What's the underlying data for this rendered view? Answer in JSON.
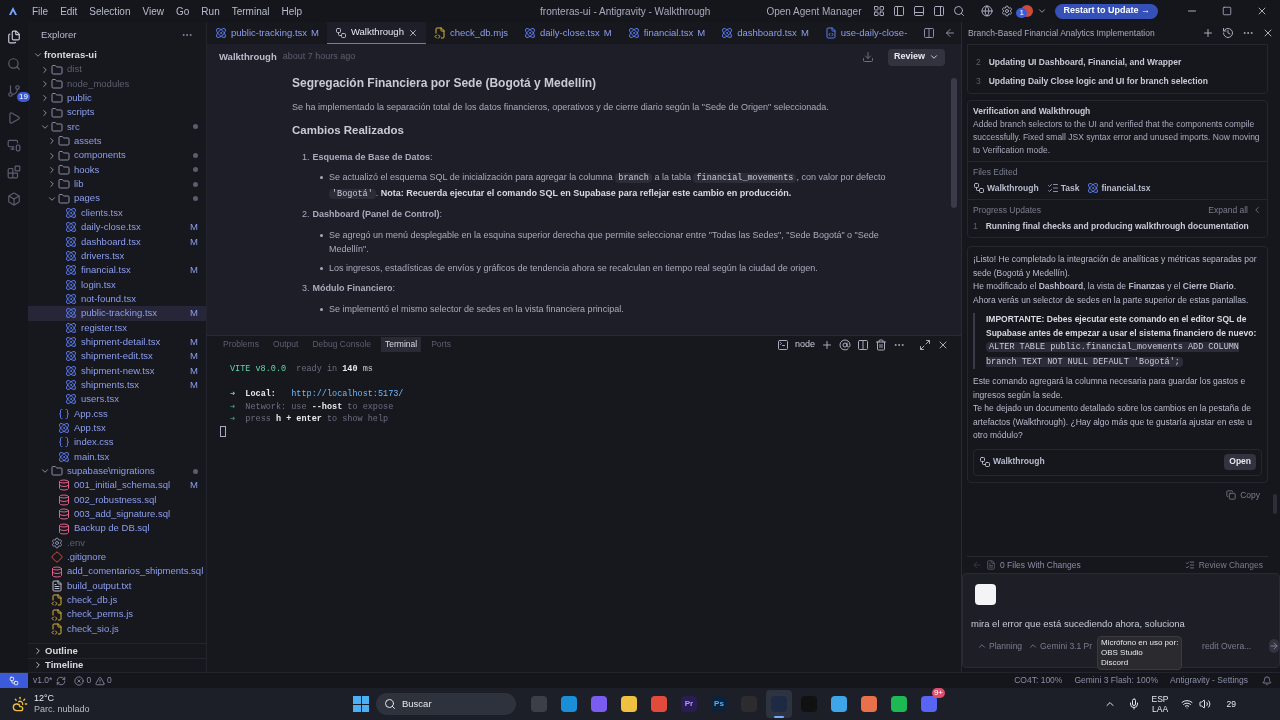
{
  "menu": [
    "File",
    "Edit",
    "Selection",
    "View",
    "Go",
    "Run",
    "Terminal",
    "Help"
  ],
  "window_title": "fronteras-ui - Antigravity - Walkthrough",
  "title_actions": {
    "agent_manager": "Open Agent Manager",
    "badge": "1",
    "update_button": "Restart to Update →"
  },
  "activity": [
    {
      "kind": "files",
      "selected": true
    },
    {
      "kind": "search",
      "selected": false
    },
    {
      "kind": "git",
      "selected": false,
      "badge": "19"
    },
    {
      "kind": "run",
      "selected": false
    },
    {
      "kind": "remote",
      "selected": false
    },
    {
      "kind": "extensions",
      "selected": false
    },
    {
      "kind": "box",
      "selected": false
    }
  ],
  "explorer": {
    "title": "Explorer",
    "tree": [
      {
        "name": "fronteras-ui",
        "kind": "root",
        "expanded": true,
        "selected": false,
        "children": [
          {
            "name": "dist",
            "kind": "folder",
            "expanded": false,
            "dimmed": true,
            "selected": false
          },
          {
            "name": "node_modules",
            "kind": "folder",
            "expanded": false,
            "dimmed": true,
            "selected": false
          },
          {
            "name": "public",
            "kind": "folder",
            "expanded": false,
            "selected": false
          },
          {
            "name": "scripts",
            "kind": "folder",
            "expanded": false,
            "selected": false
          },
          {
            "name": "src",
            "kind": "folder",
            "expanded": true,
            "changed": true,
            "selected": false,
            "children": [
              {
                "name": "assets",
                "kind": "folder",
                "expanded": false,
                "selected": false
              },
              {
                "name": "components",
                "kind": "folder",
                "expanded": false,
                "changed": true,
                "selected": false
              },
              {
                "name": "hooks",
                "kind": "folder",
                "expanded": false,
                "changed": true,
                "selected": false
              },
              {
                "name": "lib",
                "kind": "folder",
                "expanded": false,
                "changed": true,
                "selected": false
              },
              {
                "name": "pages",
                "kind": "folder",
                "expanded": true,
                "changed": true,
                "selected": false,
                "children": [
                  {
                    "name": "clients.tsx",
                    "kind": "react",
                    "selected": false
                  },
                  {
                    "name": "daily-close.tsx",
                    "kind": "react",
                    "modified": "M",
                    "selected": false
                  },
                  {
                    "name": "dashboard.tsx",
                    "kind": "react",
                    "modified": "M",
                    "selected": false
                  },
                  {
                    "name": "drivers.tsx",
                    "kind": "react",
                    "selected": false
                  },
                  {
                    "name": "financial.tsx",
                    "kind": "react",
                    "modified": "M",
                    "selected": false
                  },
                  {
                    "name": "login.tsx",
                    "kind": "react",
                    "selected": false
                  },
                  {
                    "name": "not-found.tsx",
                    "kind": "react",
                    "selected": false
                  },
                  {
                    "name": "public-tracking.tsx",
                    "kind": "react",
                    "modified": "M",
                    "selected": true
                  },
                  {
                    "name": "register.tsx",
                    "kind": "react",
                    "selected": false
                  },
                  {
                    "name": "shipment-detail.tsx",
                    "kind": "react",
                    "modified": "M",
                    "selected": false
                  },
                  {
                    "name": "shipment-edit.tsx",
                    "kind": "react",
                    "modified": "M",
                    "selected": false
                  },
                  {
                    "name": "shipment-new.tsx",
                    "kind": "react",
                    "modified": "M",
                    "selected": false
                  },
                  {
                    "name": "shipments.tsx",
                    "kind": "react",
                    "modified": "M",
                    "selected": false
                  },
                  {
                    "name": "users.tsx",
                    "kind": "react",
                    "selected": false
                  }
                ]
              },
              {
                "name": "App.css",
                "kind": "css",
                "selected": false
              },
              {
                "name": "App.tsx",
                "kind": "react",
                "selected": false
              },
              {
                "name": "index.css",
                "kind": "css",
                "selected": false
              },
              {
                "name": "main.tsx",
                "kind": "react",
                "selected": false
              }
            ]
          },
          {
            "name": "supabase\\migrations",
            "kind": "folder",
            "expanded": true,
            "changed": true,
            "selected": false,
            "children": [
              {
                "name": "001_initial_schema.sql",
                "kind": "sql",
                "modified": "M",
                "selected": false
              },
              {
                "name": "002_robustness.sql",
                "kind": "sql",
                "selected": false
              },
              {
                "name": "003_add_signature.sql",
                "kind": "sql",
                "selected": false
              },
              {
                "name": "Backup de DB.sql",
                "kind": "sql",
                "selected": false
              }
            ]
          },
          {
            "name": ".env",
            "kind": "gear",
            "dimmed": true,
            "selected": false
          },
          {
            "name": ".gitignore",
            "kind": "git",
            "selected": false
          },
          {
            "name": "add_comentarios_shipments.sql",
            "kind": "sql",
            "selected": false
          },
          {
            "name": "build_output.txt",
            "kind": "text",
            "selected": false
          },
          {
            "name": "check_db.js",
            "kind": "js",
            "selected": false
          },
          {
            "name": "check_perms.js",
            "kind": "js",
            "selected": false
          },
          {
            "name": "check_sio.js",
            "kind": "js",
            "selected": false
          }
        ]
      }
    ],
    "sections": [
      {
        "label": "Outline",
        "expanded": false
      },
      {
        "label": "Timeline",
        "expanded": false
      }
    ]
  },
  "tabs": [
    {
      "label": "public-tracking.tsx",
      "kind": "react",
      "modified": "M",
      "selected": false
    },
    {
      "label": "Walkthrough",
      "kind": "artifact",
      "selected": true
    },
    {
      "label": "check_db.mjs",
      "kind": "js",
      "selected": false
    },
    {
      "label": "daily-close.tsx",
      "kind": "react",
      "modified": "M",
      "selected": false
    },
    {
      "label": "financial.tsx",
      "kind": "react",
      "modified": "M",
      "selected": false
    },
    {
      "label": "dashboard.tsx",
      "kind": "react",
      "modified": "M",
      "selected": false
    },
    {
      "label": "use-daily-close-",
      "kind": "ts",
      "selected": false
    }
  ],
  "doc_header": {
    "title": "Walkthrough",
    "time": "about 7 hours ago",
    "review": "Review"
  },
  "document": {
    "title": "Segregación Financiera por Sede (Bogotá y Medellín)",
    "intro": "Se ha implementado la separación total de los datos financieros, operativos y de cierre diario según la \"Sede de Origen\" seleccionada.",
    "subtitle": "Cambios Realizados",
    "sections": [
      {
        "number": "1.",
        "title": "**Esquema de Base de Datos**:",
        "bullets": [
          [
            {
              "t": "Se actualizó el esquema SQL de inicialización para agregar la columna ",
              "kind": "text"
            },
            {
              "t": "branch",
              "kind": "code"
            },
            {
              "t": " a la tabla ",
              "kind": "text"
            },
            {
              "t": "financial_movements",
              "kind": "code"
            },
            {
              "t": ", con valor por defecto ",
              "kind": "text"
            },
            {
              "t": "'Bogotá'",
              "kind": "code"
            },
            {
              "t": ". ",
              "kind": "text"
            },
            {
              "t": "Nota: Recuerda ejecutar el comando SQL en Supabase para reflejar este cambio en producción.",
              "kind": "bold"
            }
          ]
        ]
      },
      {
        "number": "2.",
        "title": "**Dashboard (Panel de Control)**:",
        "bullets": [
          [
            {
              "t": "Se agregó un menú desplegable en la esquina superior derecha que permite seleccionar entre \"Todas las Sedes\", \"Sede Bogotá\" o \"Sede Medellín\".",
              "kind": "text"
            }
          ],
          [
            {
              "t": "Los ingresos, estadísticas de envíos y gráficos de tendencia ahora se recalculan en tiempo real según la ciudad de origen.",
              "kind": "text"
            }
          ]
        ]
      },
      {
        "number": "3.",
        "title": "**Módulo Financiero**:",
        "bullets": [
          [
            {
              "t": "Se implementó el mismo selector de sedes en la vista financiera principal.",
              "kind": "text"
            }
          ]
        ]
      }
    ]
  },
  "panel_tabs": [
    {
      "label": "Problems",
      "selected": false
    },
    {
      "label": "Output",
      "selected": false
    },
    {
      "label": "Debug Console",
      "selected": false
    },
    {
      "label": "Terminal",
      "selected": true
    },
    {
      "label": "Ports",
      "selected": false
    }
  ],
  "terminal": {
    "shell": "node",
    "lines": [
      [
        {
          "t": "VITE v8.0.0",
          "kind": "accent"
        },
        {
          "t": "  ready in ",
          "kind": "dim"
        },
        {
          "t": "140",
          "kind": "bold"
        },
        {
          "t": " ms",
          "kind": "plain"
        }
      ],
      [
        {
          "t": "➜  ",
          "kind": "accent"
        },
        {
          "t": "Local:   ",
          "kind": "bold"
        },
        {
          "t": "http://localhost:5173/",
          "kind": "link"
        }
      ],
      [
        {
          "t": "➜  ",
          "kind": "dimaccent"
        },
        {
          "t": "Network: use ",
          "kind": "dim"
        },
        {
          "t": "--host",
          "kind": "bold"
        },
        {
          "t": " to expose",
          "kind": "dim"
        }
      ],
      [
        {
          "t": "➜  ",
          "kind": "dimaccent"
        },
        {
          "t": "press ",
          "kind": "dim"
        },
        {
          "t": "h + enter",
          "kind": "bold"
        },
        {
          "t": " to show help",
          "kind": "dim"
        }
      ]
    ]
  },
  "agent": {
    "title": "Branch-Based Financial Analytics Implementation",
    "steps": [
      {
        "number": "2",
        "text": "Updating UI Dashboard, Financial, and Wrapper"
      },
      {
        "number": "3",
        "text": "Updating Daily Close logic and UI for branch selection"
      }
    ],
    "task": {
      "title": "Verification and Walkthrough",
      "body": "Added branch selectors to the UI and verified that the components compile successfully. Fixed small JSX syntax error and unused imports. Now moving to Verification mode.",
      "files_label": "Files Edited",
      "files": [
        {
          "name": "Walkthrough",
          "kind": "artifact"
        },
        {
          "name": "Task",
          "kind": "task"
        },
        {
          "name": "financial.tsx",
          "kind": "react"
        }
      ],
      "progress_label": "Progress Updates",
      "expand_all": "Expand all",
      "updates": [
        {
          "number": "1",
          "text": "Running final checks and producing walkthrough documentation"
        }
      ]
    },
    "message": {
      "lead": [
        "¡Listo! He completado la integración de analíticas y métricas separadas por sede (Bogotá y Medellín).",
        "He modificado el **Dashboard**, la vista de **Finanzas** y el **Cierre Diario**.",
        "Ahora verás un selector de sedes en la parte superior de estas pantallas."
      ],
      "note": [
        {
          "t": "IMPORTANTE: Debes ejecutar este comando en el editor SQL de Supabase antes de empezar a usar el sistema financiero de nuevo: ",
          "kind": "bold"
        },
        {
          "t": "ALTER TABLE public.financial_movements ADD COLUMN branch TEXT NOT NULL DEFAULT 'Bogotá';",
          "kind": "code"
        }
      ],
      "tail": [
        "Este comando agregará la columna necesaria para guardar los gastos e ingresos según la sede.",
        "Te he dejado un documento detallado sobre los cambios en la pestaña de artefactos (Walkthrough). ¿Hay algo más que te gustaría ajustar en este u otro módulo?"
      ],
      "artifact": {
        "name": "Walkthrough",
        "button": "Open"
      },
      "copy": "Copy"
    },
    "changes": {
      "label": "0 Files With Changes",
      "review": "Review Changes"
    },
    "composer": {
      "value": "mira el error que está sucediendo ahora, soluciona",
      "mode": "Planning",
      "model": "Gemini 3.1 Pr",
      "extra": "redit Overa..."
    }
  },
  "tooltip": {
    "title": "Micrófono en uso por:",
    "apps": [
      "OBS Studio",
      "Discord"
    ]
  },
  "status": {
    "version": "v1.0*",
    "errors": "0",
    "warnings": "0",
    "right": [
      "CO4T: 100%",
      "Gemini 3 Flash: 100%",
      "Antigravity - Settings"
    ]
  },
  "taskbar": {
    "temp": "12°C",
    "weather": "Parc. nublado",
    "search": "Buscar",
    "apps": [
      {
        "kind": "taskview",
        "selected": false
      },
      {
        "kind": "edge",
        "selected": false
      },
      {
        "kind": "copilot",
        "selected": false
      },
      {
        "kind": "folder",
        "selected": false
      },
      {
        "kind": "chrome",
        "selected": false
      },
      {
        "kind": "premiere",
        "label": "Pr",
        "selected": false
      },
      {
        "kind": "photoshop",
        "label": "Ps",
        "selected": false
      },
      {
        "kind": "obs",
        "selected": false
      },
      {
        "kind": "antigravity",
        "selected": true
      },
      {
        "kind": "tiktok",
        "selected": false
      },
      {
        "kind": "notepad",
        "selected": false
      },
      {
        "kind": "spark",
        "selected": false
      },
      {
        "kind": "spotify",
        "selected": false
      },
      {
        "kind": "discord",
        "badge": "9+",
        "selected": false
      }
    ],
    "lang": "ESP",
    "layout": "LAA",
    "date": "29"
  }
}
